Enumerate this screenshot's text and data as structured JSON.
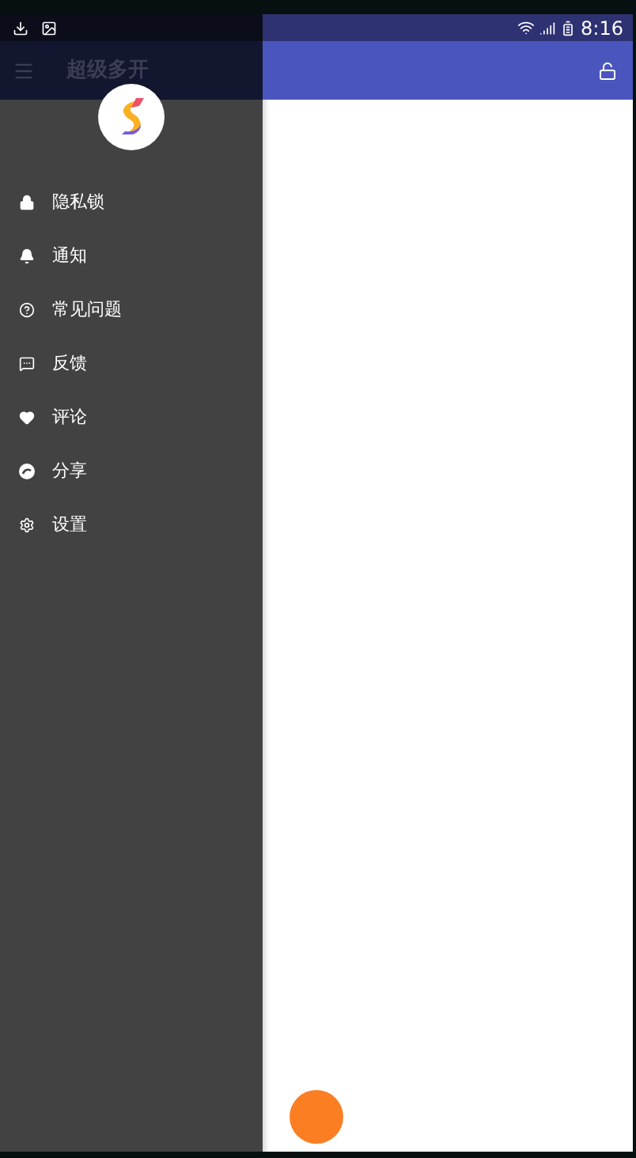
{
  "status_bar": {
    "time": "8:16"
  },
  "app_bar": {
    "title": "超级多开"
  },
  "drawer": {
    "items": [
      {
        "label": "隐私锁",
        "kind": "lock"
      },
      {
        "label": "通知",
        "kind": "bell"
      },
      {
        "label": "常见问题",
        "kind": "help"
      },
      {
        "label": "反馈",
        "kind": "feedback"
      },
      {
        "label": "评论",
        "kind": "heart"
      },
      {
        "label": "分享",
        "kind": "share"
      },
      {
        "label": "设置",
        "kind": "settings"
      }
    ]
  }
}
